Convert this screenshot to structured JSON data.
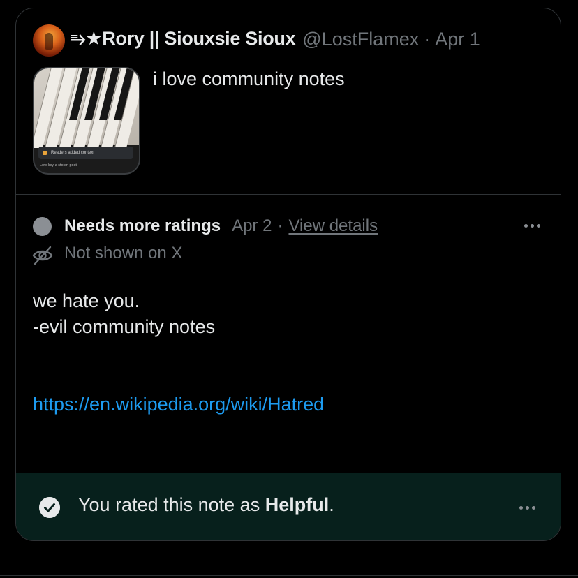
{
  "tweet": {
    "display_name": "⥱★Rory || Siouxsie Sioux",
    "handle": "@LostFlamex",
    "separator": "·",
    "date": "Apr 1",
    "text": "i love community notes",
    "thumbnail": {
      "context_label": "Readers added context",
      "note_text": "Low key a stolen post."
    }
  },
  "note": {
    "status": "Needs more ratings",
    "date": "Apr 2",
    "separator": "·",
    "view_details": "View details",
    "visibility": "Not shown on X",
    "body_line1": "we hate you.",
    "body_line2": "-evil community notes",
    "link": "https://en.wikipedia.org/wiki/Hatred"
  },
  "rating": {
    "prefix": "You rated this note as ",
    "value": "Helpful",
    "suffix": "."
  },
  "colors": {
    "background": "#000000",
    "border": "#2f3336",
    "muted_text": "#71767b",
    "link": "#1d9bf0",
    "footer_bg": "#07201c",
    "status_dot": "#8b8f94"
  }
}
